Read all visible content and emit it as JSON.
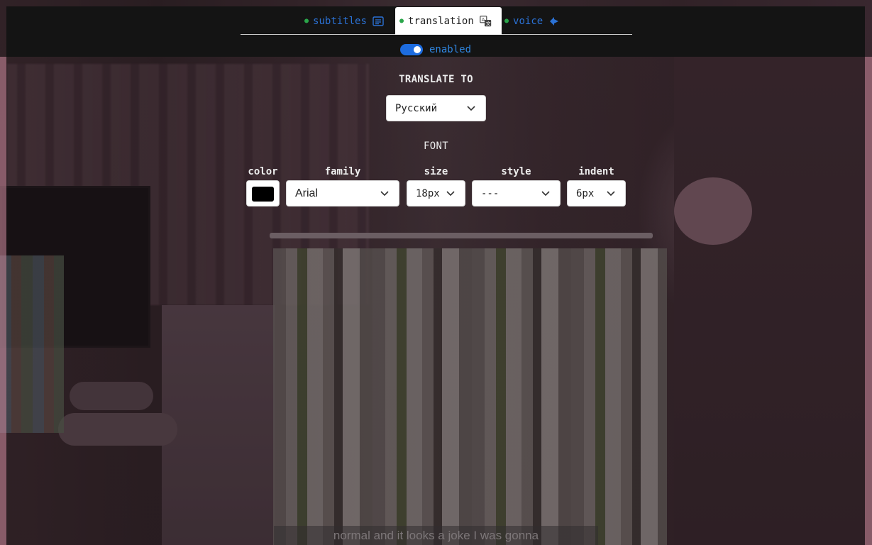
{
  "tabs": [
    {
      "label": "subtitles",
      "icon": "subtitles-icon",
      "active": false
    },
    {
      "label": "translation",
      "icon": "translate-icon",
      "active": true
    },
    {
      "label": "voice",
      "icon": "voice-icon",
      "active": false
    }
  ],
  "toggle": {
    "label": "enabled",
    "on": true
  },
  "translate": {
    "title": "TRANSLATE TO",
    "language": "Русский"
  },
  "font": {
    "title": "FONT",
    "color_label": "color",
    "color_value": "#000000",
    "family_label": "family",
    "family_value": "Arial",
    "size_label": "size",
    "size_value": "18px",
    "style_label": "style",
    "style_value": "---",
    "indent_label": "indent",
    "indent_value": "6px"
  },
  "caption": {
    "text": "normal and it looks a joke I was gonna"
  },
  "colors": {
    "accent": "#1d6ce0",
    "tab_text": "#2b72d6",
    "dot": "#2aa64a"
  }
}
